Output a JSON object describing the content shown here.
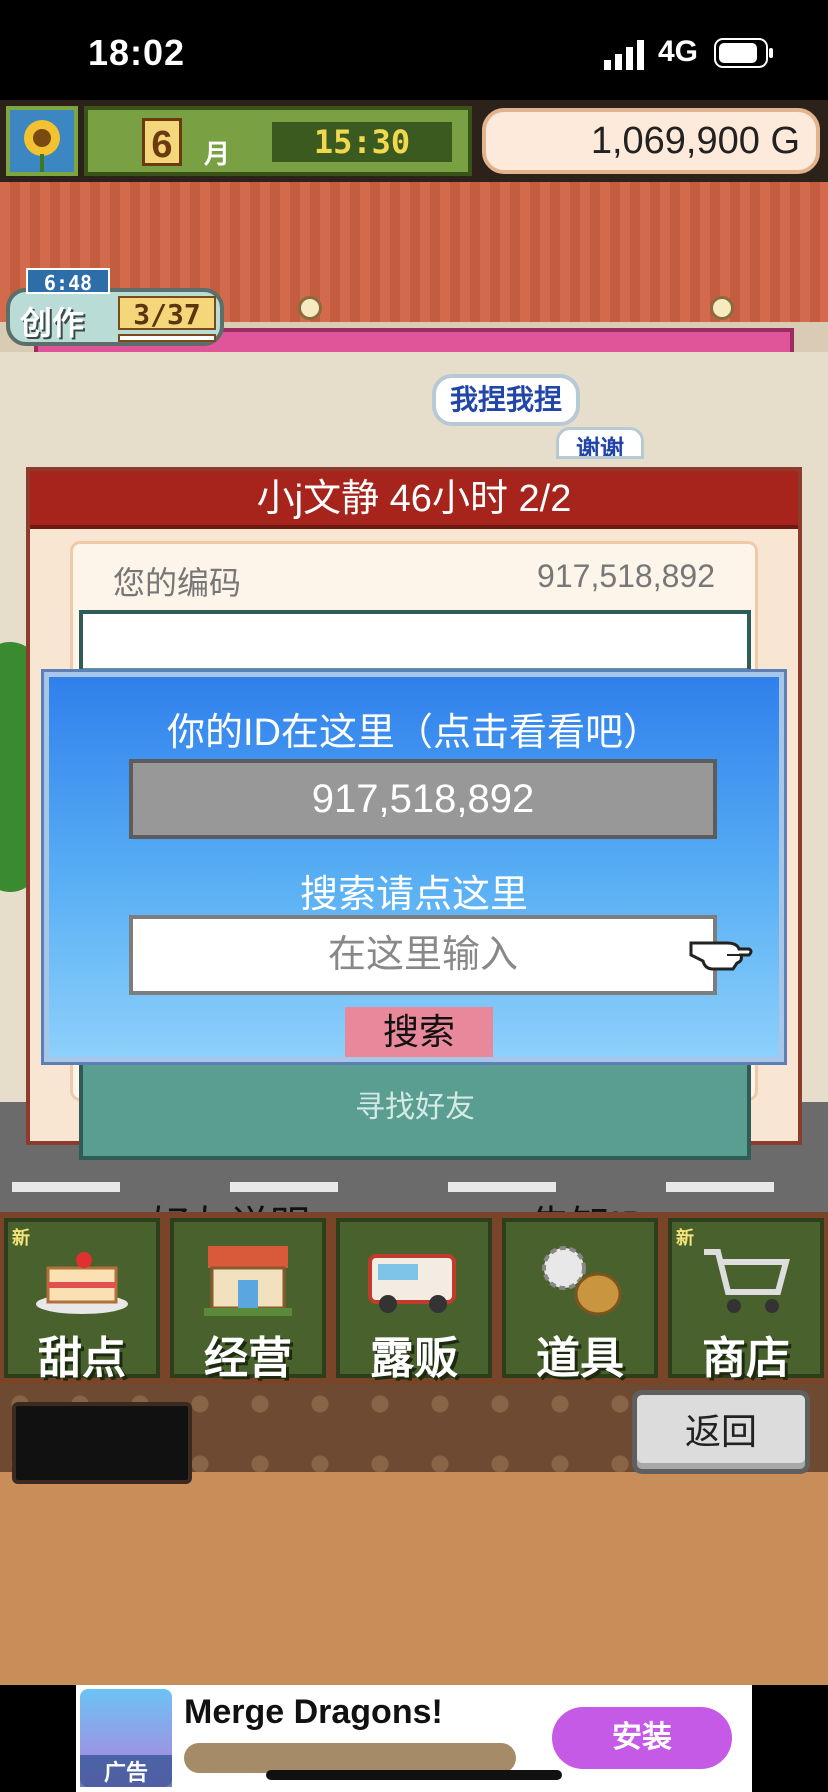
{
  "status_bar": {
    "time": "18:02",
    "network": "4G"
  },
  "hud": {
    "month_number": "6",
    "month_unit": "月",
    "clock": "15:30",
    "money": "1,069,900 G"
  },
  "create_badge": {
    "timer": "6:48",
    "label": "创作",
    "count": "3/37"
  },
  "bubbles": {
    "chat": "我捏我捏",
    "thanks": "谢谢"
  },
  "friend_panel": {
    "header": "小j文静  46小时 2/2",
    "code_label": "您的编码",
    "code_value": "917,518,892",
    "find_friend": "寻找好友",
    "help_label": "好友说明",
    "tell_id_label": "告知ID"
  },
  "id_dialog": {
    "prompt": "你的ID在这里（点击看看吧）",
    "id_value": "917,518,892",
    "search_hint": "搜索请点这里",
    "search_placeholder": "在这里输入",
    "search_button": "搜索"
  },
  "menu": {
    "items": [
      {
        "label": "甜点",
        "new": "新",
        "icon": "cake-icon"
      },
      {
        "label": "经营",
        "new": "",
        "icon": "shop-front-icon"
      },
      {
        "label": "露贩",
        "new": "",
        "icon": "food-truck-icon"
      },
      {
        "label": "道具",
        "new": "",
        "icon": "gear-bag-icon"
      },
      {
        "label": "商店",
        "new": "新",
        "icon": "cart-icon"
      }
    ]
  },
  "back_button": "返回",
  "ad": {
    "title": "Merge Dragons!",
    "tag": "广告",
    "install": "安装"
  },
  "colors": {
    "dialog_blue": "#2f80ec",
    "panel_red": "#a6241c",
    "install_purple": "#c55ae6",
    "search_pink": "#e8889a"
  }
}
